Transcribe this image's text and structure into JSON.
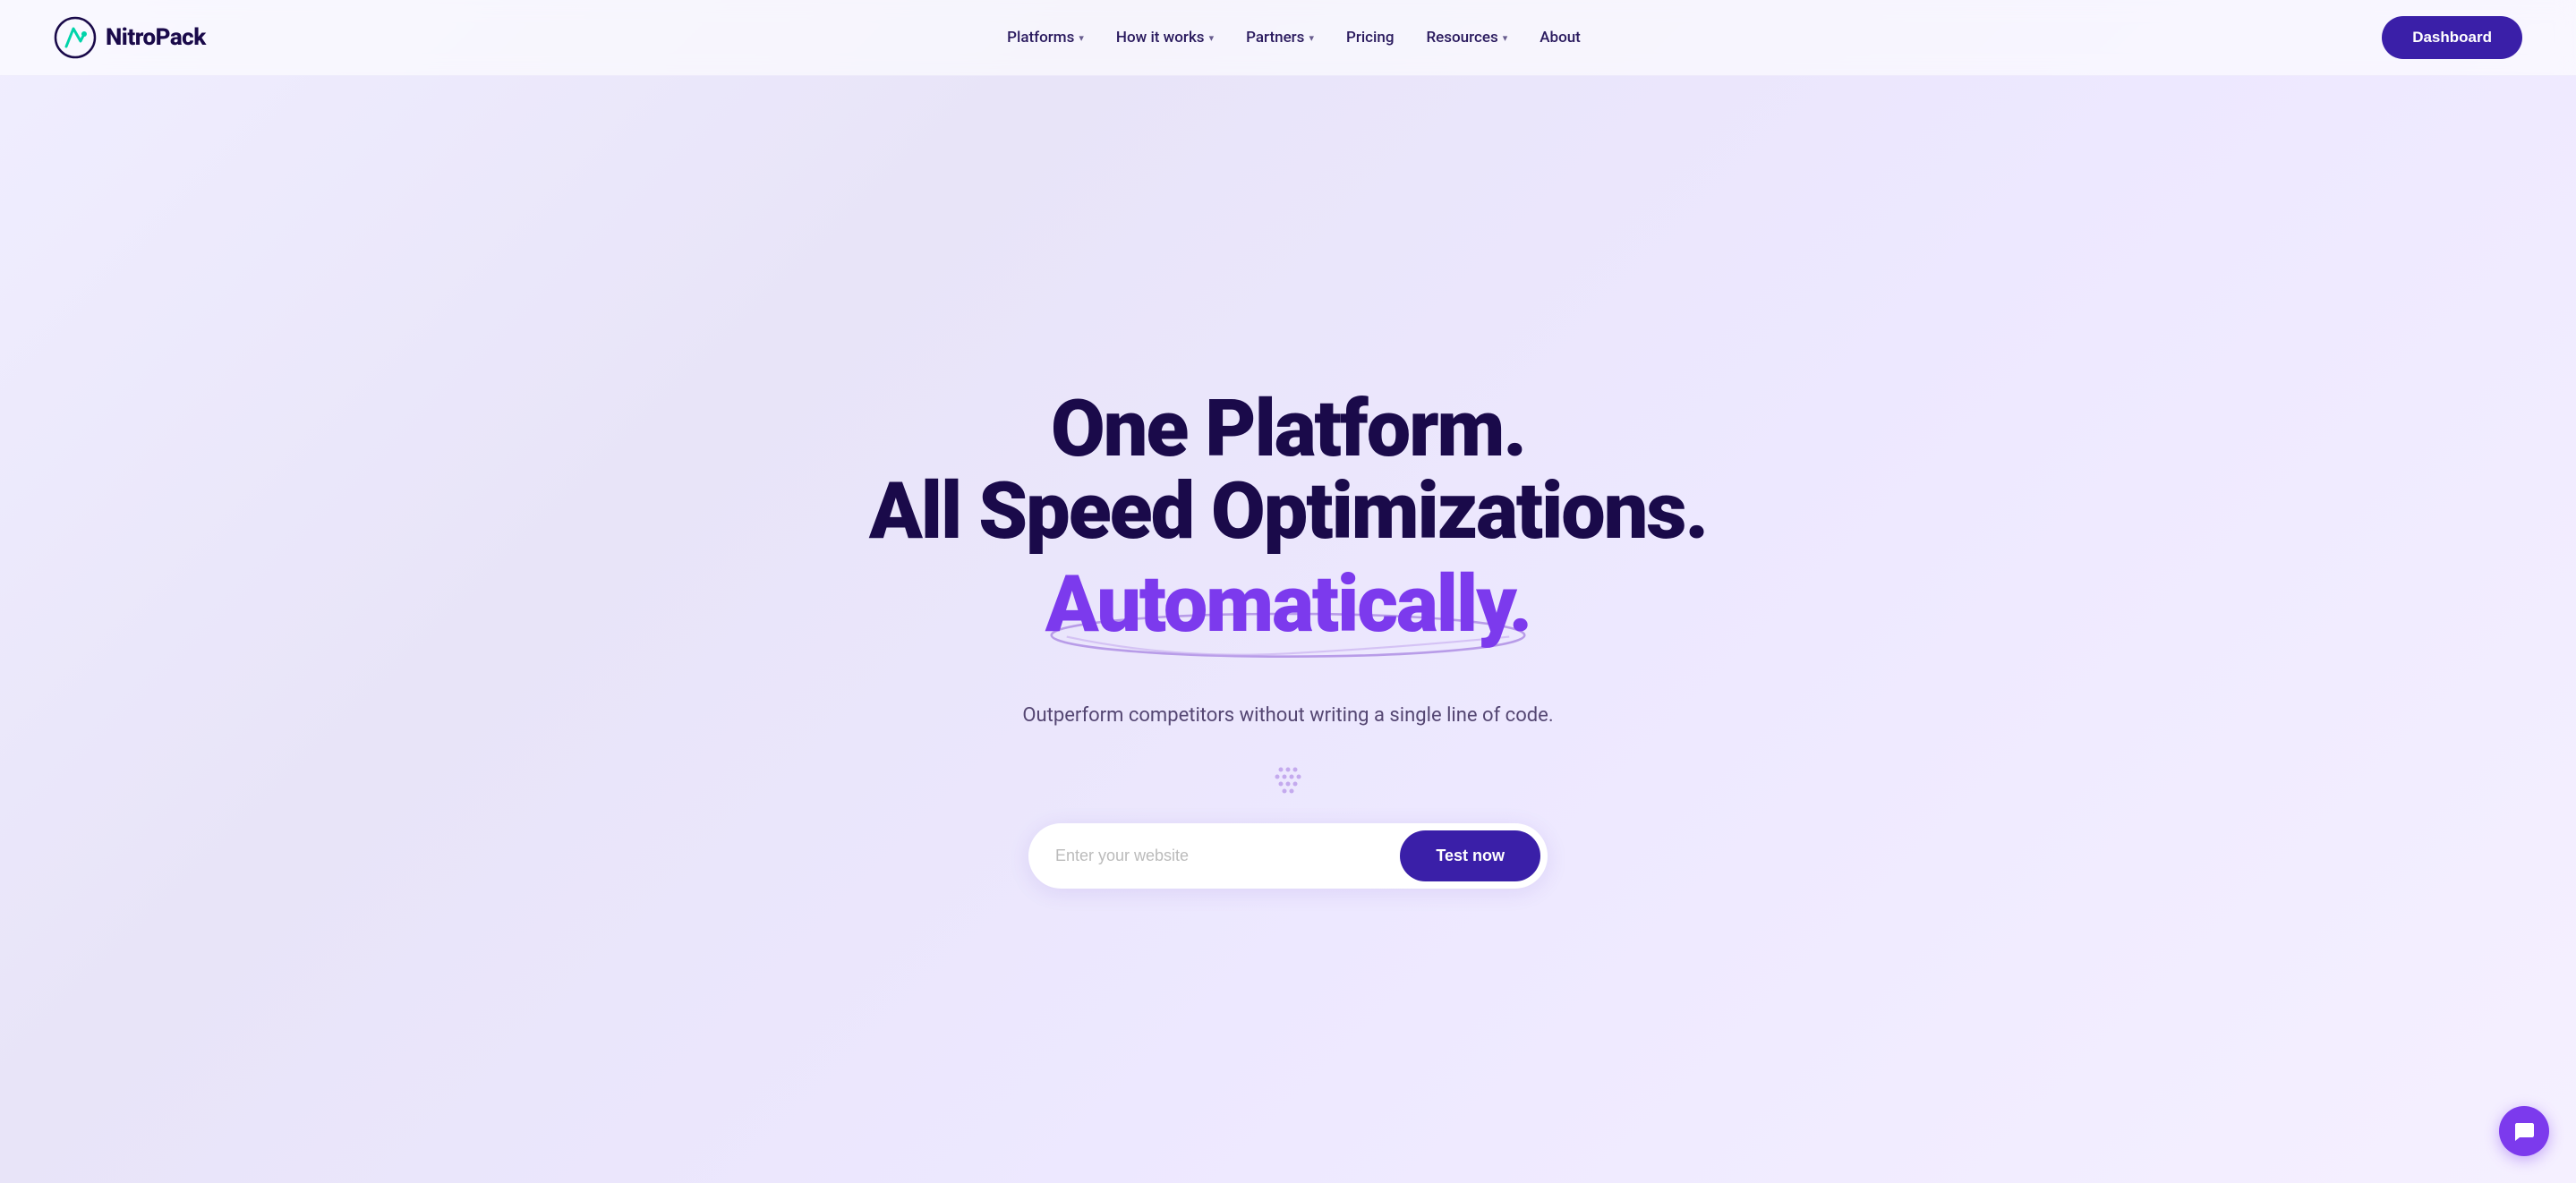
{
  "brand": {
    "name": "NitroPack",
    "logo_alt": "NitroPack logo"
  },
  "nav": {
    "items": [
      {
        "label": "Platforms",
        "has_dropdown": true
      },
      {
        "label": "How it works",
        "has_dropdown": true
      },
      {
        "label": "Partners",
        "has_dropdown": true
      },
      {
        "label": "Pricing",
        "has_dropdown": false
      },
      {
        "label": "Resources",
        "has_dropdown": true
      },
      {
        "label": "About",
        "has_dropdown": false
      }
    ],
    "dashboard_label": "Dashboard"
  },
  "hero": {
    "line1": "One Platform.",
    "line2": "All Speed Optimizations.",
    "line3": "Automatically.",
    "subtitle": "Outperform competitors without writing a single line of code.",
    "input_placeholder": "Enter your website",
    "cta_label": "Test now"
  },
  "chat": {
    "icon_label": "chat-icon"
  }
}
